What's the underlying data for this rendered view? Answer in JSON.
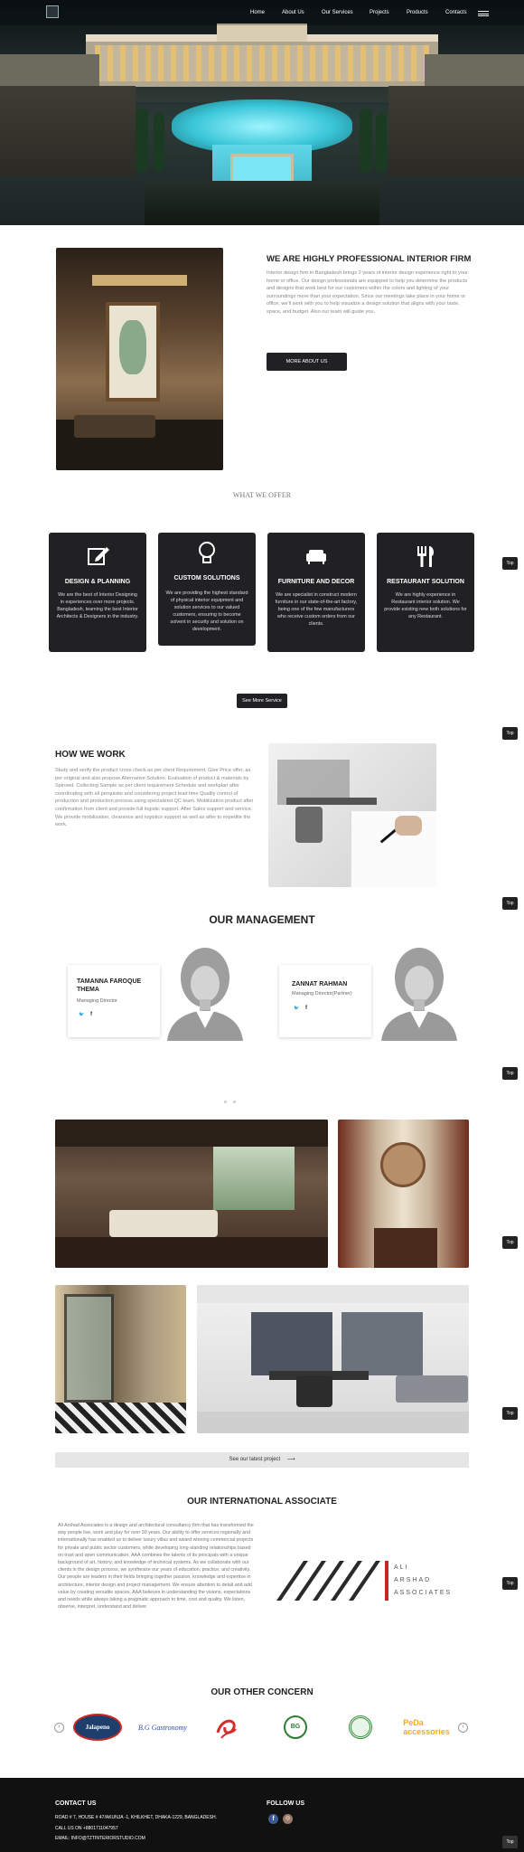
{
  "nav": {
    "items": [
      "Home",
      "About Us",
      "Our Services",
      "Projects",
      "Products",
      "Contacts"
    ]
  },
  "about": {
    "title": "WE ARE HIGHLY PROFESSIONAL INTERIOR FIRM",
    "text": "Interior design firm in Bangladesh brings 2 years of interior design experience right to your home or office. Our design professionals are equipped to help you determine the products and designs that work best for our customers within the colors and lighting of your surroundings more than your expectation. Since our meetings take place in your home or office, we'll work with you to help visualize a design solution that aligns with your taste, space, and budget. Also our team will guide you.",
    "button": "MORE ABOUT US"
  },
  "offer": {
    "title": "WHAT WE OFFER",
    "cards": [
      {
        "icon": "edit-icon",
        "title": "DESIGN & PLANNING",
        "text": "We are the best of Interior Designing in experiences over more projects. Bangladesh, teaming the best Interior Architects & Designers in the industry."
      },
      {
        "icon": "lightbulb-icon",
        "title": "CUSTOM SOLUTIONS",
        "text": "We are providing the highest standard of physical interior equipment and solution services to our valued customers, ensuring to become solvent in security and solution on development."
      },
      {
        "icon": "sofa-icon",
        "title": "FURNITURE AND DECOR",
        "text": "We are specialist in construct modern furniture in our state-of-the-art factory, being one of the few manufacturers who receive custom orders from our clients."
      },
      {
        "icon": "cutlery-icon",
        "title": "RESTAURANT SOLUTION",
        "text": "We are highly experience in Restaurant interior solution. We provide existing new both solutions for any Restaurant."
      }
    ],
    "button": "See More Service"
  },
  "how": {
    "title": "HOW WE WORK",
    "text": "Study and verify the product cross check as per client Requirement. Give Price offer, as per original and also propose Alternative Solution. Evaluation of product & materials by Spinsed. Collecting Sample as per client requirement Schedule and workplan after coordinating with all perquisite and considering project lead time Quality control of production and production process using specialized QC team. Mobilization product after confirmation from client and provide full logistic support. After Sales support and service. We provide mobilization, clearance and logistics support as well as after to expedite the work."
  },
  "management": {
    "title": "OUR MANAGEMENT",
    "people": [
      {
        "name": "TAMANNA FAROQUE THEMA",
        "role": "Managing Director"
      },
      {
        "name": "ZANNAT RAHMAN",
        "role": "Managing Director(Partner)"
      }
    ]
  },
  "projects": {
    "button": "See our latest project"
  },
  "associate": {
    "title": "OUR INTERNATIONAL ASSOCIATE",
    "text": "Ali Arshad Associates is a design and architectural consultancy firm that has transformed the way people live, work and play for over 30 years. Our ability to offer services regionally and internationally has enabled us to deliver luxury villas and award winning commercial projects for private and public sector customers, while developing long-standing relationships based on trust and open communication. AAA combines the talents of its principals with a unique background of art, history, and knowledge of technical systems. As we collaborate with our clients in the design process, we synthesize our years of education, practice, and creativity. Our people are leaders in their fields bringing together passion, knowledge and expertise in architecture, interior design and project management. We ensure attention to detail and add value by creating versatile spaces. AAA believes in understanding the visions, expectations and needs while always taking a pragmatic approach to time, cost and quality. We listen, observe, interpret, understand and deliver.",
    "logo_line1": "ALI",
    "logo_line2": "ARSHAD",
    "logo_line3": "ASSOCIATES"
  },
  "concern": {
    "title": "OUR OTHER CONCERN",
    "logos": [
      "Jalapeno",
      "B.G Gastronomy",
      "PeDa accessories"
    ]
  },
  "footer": {
    "contact_title": "CONTACT US",
    "address": "ROAD # 7, HOUSE # 47/AKUNJA -1, KHILKHET, DHAKA-1229, BANGLADESH.",
    "call": "CALL US ON +8801711047957",
    "email": "EMAIL: INFO@TZTINTERIORSTUDIO.COM",
    "follow_title": "FOLLOW US"
  },
  "top_label": "Top",
  "colors": {
    "dark": "#212023",
    "footer": "#111111"
  }
}
